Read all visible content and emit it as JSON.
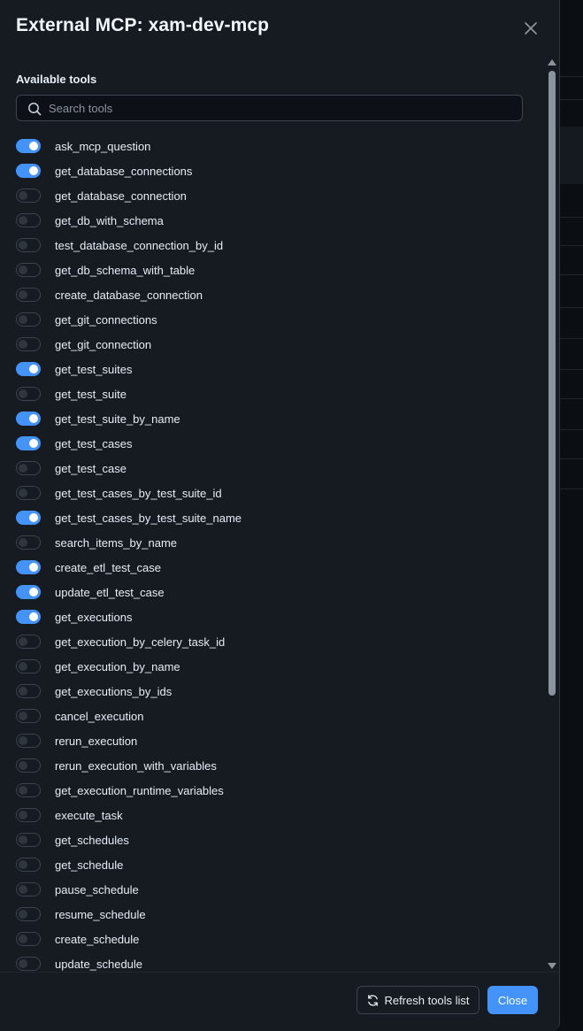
{
  "dialog": {
    "title": "External MCP: xam-dev-mcp",
    "section_label": "Available tools",
    "search_placeholder": "Search tools",
    "search_value": ""
  },
  "tools": [
    {
      "name": "ask_mcp_question",
      "enabled": true
    },
    {
      "name": "get_database_connections",
      "enabled": true
    },
    {
      "name": "get_database_connection",
      "enabled": false
    },
    {
      "name": "get_db_with_schema",
      "enabled": false
    },
    {
      "name": "test_database_connection_by_id",
      "enabled": false
    },
    {
      "name": "get_db_schema_with_table",
      "enabled": false
    },
    {
      "name": "create_database_connection",
      "enabled": false
    },
    {
      "name": "get_git_connections",
      "enabled": false
    },
    {
      "name": "get_git_connection",
      "enabled": false
    },
    {
      "name": "get_test_suites",
      "enabled": true
    },
    {
      "name": "get_test_suite",
      "enabled": false
    },
    {
      "name": "get_test_suite_by_name",
      "enabled": true
    },
    {
      "name": "get_test_cases",
      "enabled": true
    },
    {
      "name": "get_test_case",
      "enabled": false
    },
    {
      "name": "get_test_cases_by_test_suite_id",
      "enabled": false
    },
    {
      "name": "get_test_cases_by_test_suite_name",
      "enabled": true
    },
    {
      "name": "search_items_by_name",
      "enabled": false
    },
    {
      "name": "create_etl_test_case",
      "enabled": true
    },
    {
      "name": "update_etl_test_case",
      "enabled": true
    },
    {
      "name": "get_executions",
      "enabled": true
    },
    {
      "name": "get_execution_by_celery_task_id",
      "enabled": false
    },
    {
      "name": "get_execution_by_name",
      "enabled": false
    },
    {
      "name": "get_executions_by_ids",
      "enabled": false
    },
    {
      "name": "cancel_execution",
      "enabled": false
    },
    {
      "name": "rerun_execution",
      "enabled": false
    },
    {
      "name": "rerun_execution_with_variables",
      "enabled": false
    },
    {
      "name": "get_execution_runtime_variables",
      "enabled": false
    },
    {
      "name": "execute_task",
      "enabled": false
    },
    {
      "name": "get_schedules",
      "enabled": false
    },
    {
      "name": "get_schedule",
      "enabled": false
    },
    {
      "name": "pause_schedule",
      "enabled": false
    },
    {
      "name": "resume_schedule",
      "enabled": false
    },
    {
      "name": "create_schedule",
      "enabled": false
    },
    {
      "name": "update_schedule",
      "enabled": false
    }
  ],
  "footer": {
    "refresh_label": "Refresh tools list",
    "close_label": "Close"
  },
  "icons": {
    "close": "close-icon",
    "search": "search-icon",
    "refresh": "refresh-icon"
  },
  "colors": {
    "accent": "#4493f8",
    "background": "#161b22"
  }
}
